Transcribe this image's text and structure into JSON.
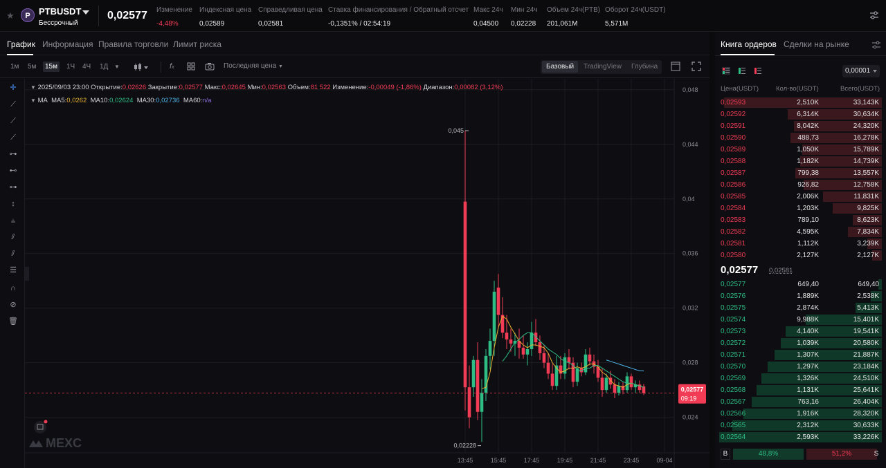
{
  "header": {
    "symbol": "PTBUSDT",
    "contract_type": "Бессрочный",
    "logo_letter": "P",
    "last_price": "0,02577",
    "stats": [
      {
        "label": "Изменение",
        "value": "-4,48%",
        "color": "red"
      },
      {
        "label": "Индексная цена",
        "value": "0,02589"
      },
      {
        "label": "Справедливая цена",
        "value": "0,02581"
      },
      {
        "label": "Ставка финансирования / Обратный отсчет",
        "value": "-0,1351% / 02:54:19"
      },
      {
        "label": "Макс 24ч",
        "value": "0,04500"
      },
      {
        "label": "Мин 24ч",
        "value": "0,02228"
      },
      {
        "label": "Объем 24ч(PTB)",
        "value": "201,061M"
      },
      {
        "label": "Оборот 24ч(USDT)",
        "value": "5,571M"
      }
    ]
  },
  "chart_tabs": [
    "График",
    "Информация",
    "Правила торговли",
    "Лимит риска"
  ],
  "toolbar": {
    "timeframes": [
      "1м",
      "5м",
      "15м",
      "1Ч",
      "4Ч",
      "1Д"
    ],
    "active_timeframe": "15м",
    "price_type": "Последняя цена",
    "views": [
      "Базовый",
      "TradingView",
      "Глубина"
    ],
    "active_view": "Базовый"
  },
  "legend": {
    "time": "2025/09/03 23:00",
    "open_label": "Открытие:",
    "open": "0,02626",
    "close_label": "Закрытие:",
    "close": "0,02577",
    "high_label": "Макс:",
    "high": "0,02645",
    "low_label": "Мин:",
    "low": "0,02563",
    "vol_label": "Объем:",
    "vol": "81 522",
    "chg_label": "Изменение:",
    "chg": "-0,00049 (-1,86%)",
    "range_label": "Диапазон:",
    "range": "0,00082 (3,12%)",
    "ma_title": "MA",
    "ma5_label": "MA5:",
    "ma5": "0,0262",
    "ma10_label": "MA10:",
    "ma10": "0,02624",
    "ma30_label": "MA30:",
    "ma30": "0,02736",
    "ma60_label": "MA60:",
    "ma60": "n/a"
  },
  "chart_data": {
    "type": "candlestick",
    "y_ticks": [
      "0,048",
      "0,044",
      "0,04",
      "0,036",
      "0,032",
      "0,028",
      "0,024"
    ],
    "ylim": [
      0.0214,
      0.0488
    ],
    "x_ticks": [
      "13:45",
      "15:45",
      "17:45",
      "19:45",
      "21:45",
      "23:45",
      "09-04"
    ],
    "high_marker": "0,045",
    "low_marker": "0,02228",
    "current_price_tag": "0,02577",
    "countdown_tag": "09:19",
    "watermark": "MEXC",
    "colors": {
      "up": "#2ebd85",
      "down": "#f23c55",
      "ma5": "#e8b030",
      "ma10": "#2ebd85",
      "ma30": "#4db3ea"
    },
    "candles": [
      {
        "o": 0.0398,
        "h": 0.045,
        "l": 0.0245,
        "c": 0.0262
      },
      {
        "o": 0.0262,
        "h": 0.0278,
        "l": 0.0232,
        "c": 0.024
      },
      {
        "o": 0.0262,
        "h": 0.0285,
        "l": 0.0255,
        "c": 0.0282
      },
      {
        "o": 0.0282,
        "h": 0.0295,
        "l": 0.0238,
        "c": 0.0244
      },
      {
        "o": 0.0244,
        "h": 0.0268,
        "l": 0.0222,
        "c": 0.0258
      },
      {
        "o": 0.0258,
        "h": 0.029,
        "l": 0.0252,
        "c": 0.0285
      },
      {
        "o": 0.0285,
        "h": 0.0305,
        "l": 0.0275,
        "c": 0.0296
      },
      {
        "o": 0.0296,
        "h": 0.034,
        "l": 0.0285,
        "c": 0.0332
      },
      {
        "o": 0.0335,
        "h": 0.0345,
        "l": 0.0305,
        "c": 0.0315
      },
      {
        "o": 0.0315,
        "h": 0.0328,
        "l": 0.0298,
        "c": 0.0302
      },
      {
        "o": 0.0302,
        "h": 0.0315,
        "l": 0.029,
        "c": 0.0297
      },
      {
        "o": 0.0297,
        "h": 0.0305,
        "l": 0.0288,
        "c": 0.0294
      },
      {
        "o": 0.0294,
        "h": 0.0302,
        "l": 0.0285,
        "c": 0.0296
      },
      {
        "o": 0.0296,
        "h": 0.0305,
        "l": 0.0283,
        "c": 0.0291
      },
      {
        "o": 0.0291,
        "h": 0.03,
        "l": 0.0283,
        "c": 0.0286
      },
      {
        "o": 0.0286,
        "h": 0.0295,
        "l": 0.0278,
        "c": 0.029
      },
      {
        "o": 0.029,
        "h": 0.031,
        "l": 0.0285,
        "c": 0.0302
      },
      {
        "o": 0.0302,
        "h": 0.0312,
        "l": 0.0292,
        "c": 0.0295
      },
      {
        "o": 0.0295,
        "h": 0.03,
        "l": 0.0282,
        "c": 0.0287
      },
      {
        "o": 0.0287,
        "h": 0.0293,
        "l": 0.0276,
        "c": 0.028
      },
      {
        "o": 0.028,
        "h": 0.0287,
        "l": 0.0268,
        "c": 0.0272
      },
      {
        "o": 0.0272,
        "h": 0.0279,
        "l": 0.026,
        "c": 0.0263
      },
      {
        "o": 0.0263,
        "h": 0.0285,
        "l": 0.026,
        "c": 0.0278
      },
      {
        "o": 0.0278,
        "h": 0.0285,
        "l": 0.0268,
        "c": 0.0272
      },
      {
        "o": 0.0272,
        "h": 0.0287,
        "l": 0.0268,
        "c": 0.0284
      },
      {
        "o": 0.0284,
        "h": 0.029,
        "l": 0.0275,
        "c": 0.028
      },
      {
        "o": 0.028,
        "h": 0.0284,
        "l": 0.0262,
        "c": 0.0266
      },
      {
        "o": 0.0266,
        "h": 0.028,
        "l": 0.0263,
        "c": 0.0276
      },
      {
        "o": 0.0276,
        "h": 0.028,
        "l": 0.027,
        "c": 0.0273
      },
      {
        "o": 0.0273,
        "h": 0.029,
        "l": 0.0271,
        "c": 0.0286
      },
      {
        "o": 0.0286,
        "h": 0.0291,
        "l": 0.0278,
        "c": 0.0281
      },
      {
        "o": 0.0281,
        "h": 0.0286,
        "l": 0.0272,
        "c": 0.0277
      },
      {
        "o": 0.0277,
        "h": 0.0282,
        "l": 0.0266,
        "c": 0.0269
      },
      {
        "o": 0.0269,
        "h": 0.0276,
        "l": 0.0255,
        "c": 0.026
      },
      {
        "o": 0.026,
        "h": 0.0272,
        "l": 0.0258,
        "c": 0.0269
      },
      {
        "o": 0.0269,
        "h": 0.0274,
        "l": 0.0261,
        "c": 0.0264
      },
      {
        "o": 0.0264,
        "h": 0.0268,
        "l": 0.0254,
        "c": 0.0258
      },
      {
        "o": 0.0258,
        "h": 0.0266,
        "l": 0.0256,
        "c": 0.0263
      },
      {
        "o": 0.0263,
        "h": 0.0266,
        "l": 0.0257,
        "c": 0.026
      },
      {
        "o": 0.026,
        "h": 0.0273,
        "l": 0.0258,
        "c": 0.027
      },
      {
        "o": 0.027,
        "h": 0.0272,
        "l": 0.026,
        "c": 0.0262
      },
      {
        "o": 0.0262,
        "h": 0.0267,
        "l": 0.0258,
        "c": 0.0264
      },
      {
        "o": 0.0264,
        "h": 0.0267,
        "l": 0.0258,
        "c": 0.026
      },
      {
        "o": 0.02626,
        "h": 0.02645,
        "l": 0.02563,
        "c": 0.02577
      }
    ],
    "ma5": [
      null,
      null,
      null,
      null,
      0.0261,
      0.0262,
      0.0273,
      0.0291,
      0.0306,
      0.0314,
      0.0312,
      0.0306,
      0.0301,
      0.0296,
      0.0293,
      0.0291,
      0.0293,
      0.0293,
      0.0292,
      0.0291,
      0.0287,
      0.028,
      0.0276,
      0.0273,
      0.0274,
      0.0276,
      0.0276,
      0.0277,
      0.0276,
      0.0277,
      0.0279,
      0.0279,
      0.0277,
      0.0273,
      0.0271,
      0.0267,
      0.0264,
      0.0263,
      0.0262,
      0.0264,
      0.0265,
      0.0264,
      0.0263,
      0.0262
    ],
    "ma10": [
      null,
      null,
      null,
      null,
      null,
      null,
      null,
      null,
      null,
      0.0281,
      0.0285,
      0.029,
      0.0295,
      0.0297,
      0.03,
      0.0302,
      0.0302,
      0.0299,
      0.0296,
      0.0293,
      0.029,
      0.0288,
      0.0286,
      0.0283,
      0.0281,
      0.028,
      0.0278,
      0.0275,
      0.0274,
      0.0276,
      0.0276,
      0.0278,
      0.0278,
      0.0276,
      0.0274,
      0.0272,
      0.027,
      0.0268,
      0.0266,
      0.0265,
      0.0265,
      0.0264,
      0.0263,
      0.0262
    ],
    "ma30": [
      null,
      null,
      null,
      null,
      null,
      null,
      null,
      null,
      null,
      null,
      null,
      null,
      null,
      null,
      null,
      null,
      null,
      null,
      null,
      null,
      null,
      null,
      null,
      null,
      null,
      null,
      null,
      null,
      null,
      null,
      null,
      null,
      null,
      null,
      0.0282,
      0.0281,
      0.028,
      0.0279,
      0.0278,
      0.0277,
      0.0276,
      0.0275,
      0.0274,
      0.0274
    ]
  },
  "book": {
    "tabs": [
      "Книга ордеров",
      "Сделки на рынке"
    ],
    "precision": "0,00001",
    "columns": [
      "Цена(USDT)",
      "Кол-во(USDT)",
      "Всего(USDT)"
    ],
    "asks": [
      {
        "price": "0,02593",
        "qty": "2,510K",
        "total": "33,143K",
        "depth": 0.97
      },
      {
        "price": "0,02592",
        "qty": "6,314K",
        "total": "30,634K",
        "depth": 0.58
      },
      {
        "price": "0,02591",
        "qty": "8,042K",
        "total": "24,320K",
        "depth": 0.54
      },
      {
        "price": "0,02590",
        "qty": "488,73",
        "total": "16,278K",
        "depth": 0.56
      },
      {
        "price": "0,02589",
        "qty": "1,050K",
        "total": "15,789K",
        "depth": 0.49
      },
      {
        "price": "0,02588",
        "qty": "1,182K",
        "total": "14,739K",
        "depth": 0.5
      },
      {
        "price": "0,02587",
        "qty": "799,38",
        "total": "13,557K",
        "depth": 0.53
      },
      {
        "price": "0,02586",
        "qty": "926,82",
        "total": "12,758K",
        "depth": 0.48
      },
      {
        "price": "0,02585",
        "qty": "2,006K",
        "total": "11,831K",
        "depth": 0.36
      },
      {
        "price": "0,02584",
        "qty": "1,203K",
        "total": "9,825K",
        "depth": 0.3
      },
      {
        "price": "0,02583",
        "qty": "789,10",
        "total": "8,623K",
        "depth": 0.18
      },
      {
        "price": "0,02582",
        "qty": "4,595K",
        "total": "7,834K",
        "depth": 0.21
      },
      {
        "price": "0,02581",
        "qty": "1,112K",
        "total": "3,239K",
        "depth": 0.09
      },
      {
        "price": "0,02580",
        "qty": "2,127K",
        "total": "2,127K",
        "depth": 0.06
      }
    ],
    "mid_price": "0,02577",
    "mark_price": "0,02581",
    "bids": [
      {
        "price": "0,02577",
        "qty": "649,40",
        "total": "649,40",
        "depth": 0.02
      },
      {
        "price": "0,02576",
        "qty": "1,889K",
        "total": "2,538K",
        "depth": 0.07
      },
      {
        "price": "0,02575",
        "qty": "2,874K",
        "total": "5,413K",
        "depth": 0.16
      },
      {
        "price": "0,02574",
        "qty": "9,988K",
        "total": "15,401K",
        "depth": 0.47
      },
      {
        "price": "0,02573",
        "qty": "4,140K",
        "total": "19,541K",
        "depth": 0.59
      },
      {
        "price": "0,02572",
        "qty": "1,039K",
        "total": "20,580K",
        "depth": 0.62
      },
      {
        "price": "0,02571",
        "qty": "1,307K",
        "total": "21,887K",
        "depth": 0.66
      },
      {
        "price": "0,02570",
        "qty": "1,297K",
        "total": "23,184K",
        "depth": 0.7
      },
      {
        "price": "0,02569",
        "qty": "1,326K",
        "total": "24,510K",
        "depth": 0.74
      },
      {
        "price": "0,02568",
        "qty": "1,131K",
        "total": "25,641K",
        "depth": 0.77
      },
      {
        "price": "0,02567",
        "qty": "763,16",
        "total": "26,404K",
        "depth": 0.8
      },
      {
        "price": "0,02566",
        "qty": "1,916K",
        "total": "28,320K",
        "depth": 0.85
      },
      {
        "price": "0,02565",
        "qty": "2,312K",
        "total": "30,633K",
        "depth": 0.92
      },
      {
        "price": "0,02564",
        "qty": "2,593K",
        "total": "33,226K",
        "depth": 1.0
      }
    ],
    "buy_label": "B",
    "buy_pct": "48,8%",
    "buy_ratio": 0.488,
    "sell_label": "S",
    "sell_pct": "51,2%"
  }
}
